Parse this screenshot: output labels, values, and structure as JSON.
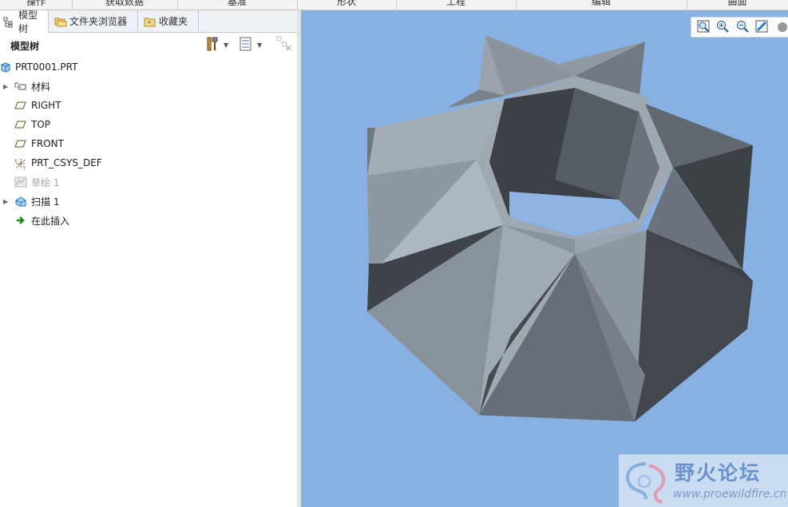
{
  "ribbon": {
    "groups": [
      "操作",
      "获取数据",
      "基准",
      "形状",
      "工程",
      "编辑",
      "曲面"
    ]
  },
  "left_panel": {
    "tabs": [
      {
        "label": "模型树",
        "icon": "model-tree-icon",
        "active": true
      },
      {
        "label": "文件夹浏览器",
        "icon": "folder-browser-icon",
        "active": false
      },
      {
        "label": "收藏夹",
        "icon": "favorites-icon",
        "active": false
      }
    ],
    "tree_title": "模型树",
    "tree_items": [
      {
        "label": "PRT0001.PRT",
        "icon": "part-icon",
        "expander": false,
        "dim": false
      },
      {
        "label": "材料",
        "icon": "material-icon",
        "expander": true,
        "dim": false
      },
      {
        "label": "RIGHT",
        "icon": "datum-plane-icon",
        "expander": false,
        "dim": false
      },
      {
        "label": "TOP",
        "icon": "datum-plane-icon",
        "expander": false,
        "dim": false
      },
      {
        "label": "FRONT",
        "icon": "datum-plane-icon",
        "expander": false,
        "dim": false
      },
      {
        "label": "PRT_CSYS_DEF",
        "icon": "coordinate-system-icon",
        "expander": false,
        "dim": false
      },
      {
        "label": "草绘 1",
        "icon": "sketch-icon",
        "expander": false,
        "dim": true
      },
      {
        "label": "扫描 1",
        "icon": "sweep-icon",
        "expander": true,
        "dim": false
      },
      {
        "label": "在此插入",
        "icon": "insert-here-arrow-icon",
        "expander": false,
        "dim": false
      }
    ]
  },
  "view_toolbar": {
    "icons": [
      "refit-icon",
      "zoom-in-icon",
      "zoom-out-icon",
      "repaint-icon",
      "display-style-icon"
    ]
  },
  "watermark": {
    "title": "野火论坛",
    "url": "www.proewildfire.cn"
  },
  "colors": {
    "viewport_bg": "#88b1e3",
    "model_light": "#a9b4bd",
    "model_mid": "#848e97",
    "model_dark": "#3e4349"
  }
}
